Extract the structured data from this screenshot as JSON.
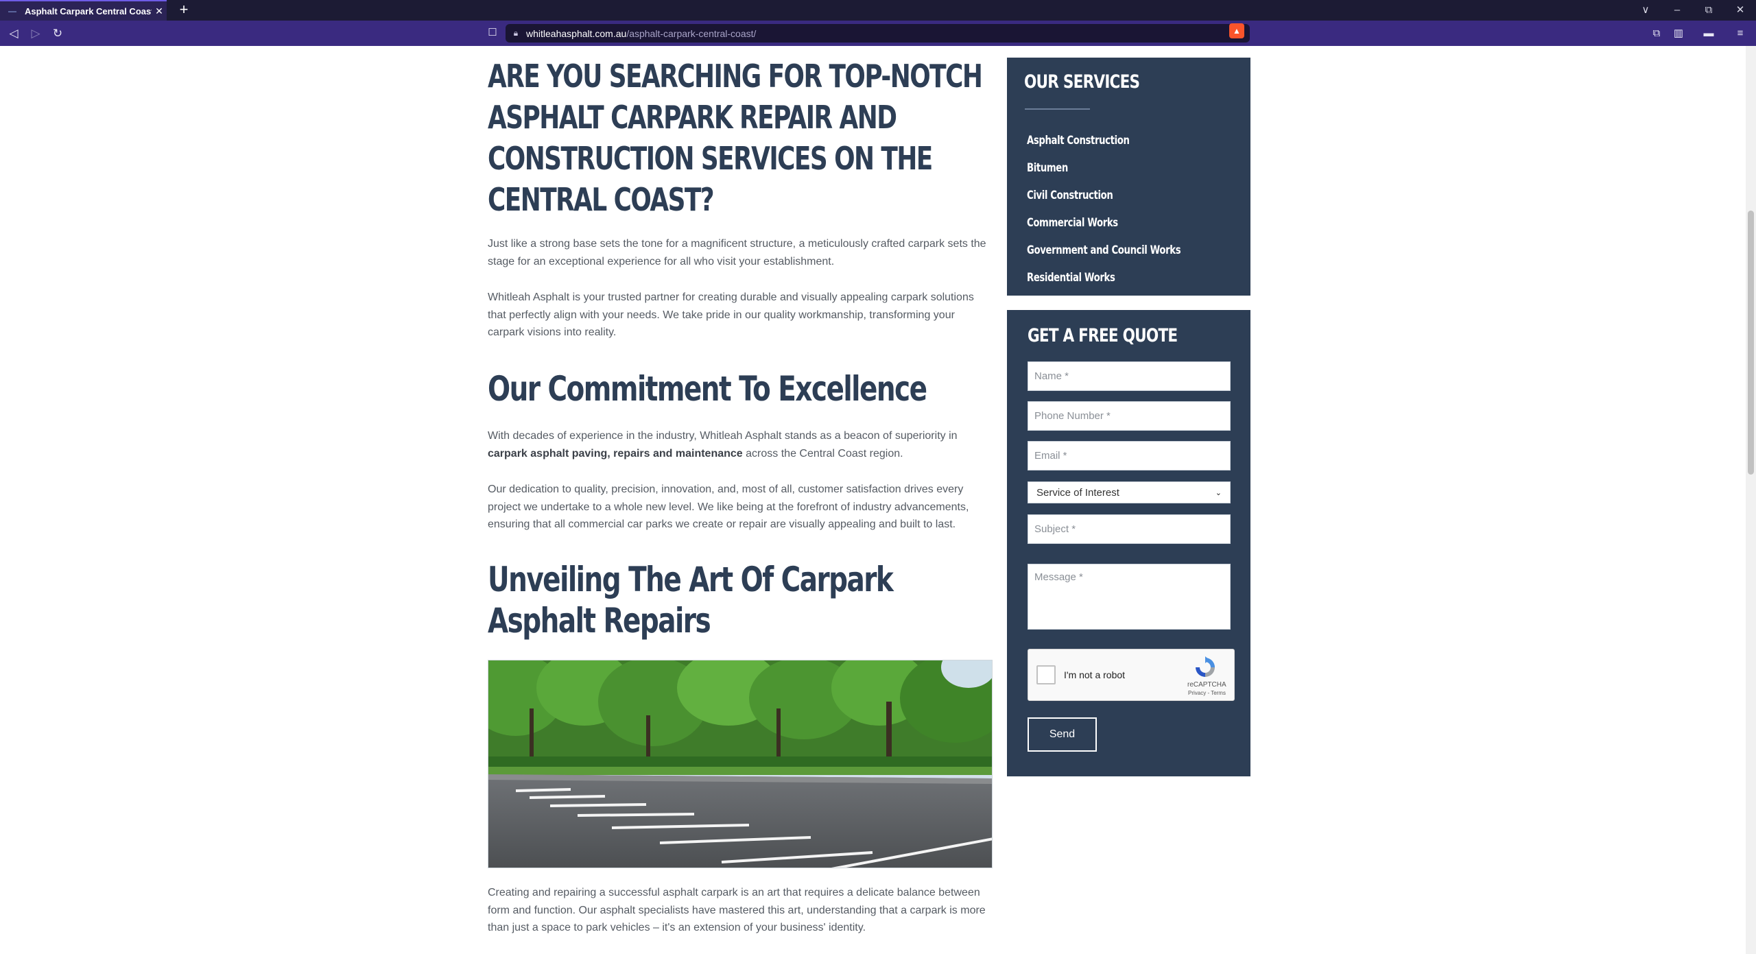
{
  "browser": {
    "tab_title": "Asphalt Carpark Central Coast - W",
    "new_tab_label": "+",
    "url_host": "whitleahasphalt.com.au",
    "url_path": "/asphalt-carpark-central-coast/"
  },
  "article": {
    "heading": "ARE YOU SEARCHING FOR TOP-NOTCH ASPHALT CARPARK REPAIR AND CONSTRUCTION SERVICES ON THE CENTRAL COAST?",
    "intro_p1": "Just like a strong base sets the tone for a magnificent structure, a meticulously crafted carpark sets the stage for an exceptional experience for all who visit your establishment.",
    "intro_p2": "Whitleah Asphalt is your trusted partner for creating durable and visually appealing carpark solutions that perfectly align with your needs. We take pride in our quality workmanship, transforming your carpark visions into reality.",
    "section1_heading": "Our Commitment To Excellence",
    "section1_p1_before": "With decades of experience in the industry, Whitleah Asphalt stands as a beacon of superiority in ",
    "section1_p1_bold": "carpark asphalt paving, repairs and maintenance",
    "section1_p1_after": " across the Central Coast region.",
    "section1_p2": "Our dedication to quality, precision, innovation, and, most of all, customer satisfaction drives every project we undertake to a whole new level. We like being at the forefront of industry advancements, ensuring that all commercial car parks we create or repair are visually appealing and built to last.",
    "section2_heading": "Unveiling The Art Of Carpark Asphalt Repairs",
    "section2_p1": "Creating and repairing a successful asphalt carpark is an art that requires a delicate balance between form and function. Our asphalt specialists have mastered this art, understanding that a carpark is more than just a space to park vehicles – it's an extension of your business' identity."
  },
  "services": {
    "title": "OUR SERVICES",
    "items": [
      "Asphalt Construction",
      "Bitumen",
      "Civil Construction",
      "Commercial Works",
      "Government and Council Works",
      "Residential Works"
    ]
  },
  "quote_form": {
    "title": "GET A FREE QUOTE",
    "name_placeholder": "Name *",
    "phone_placeholder": "Phone Number *",
    "email_placeholder": "Email *",
    "service_selected": "Service of Interest",
    "subject_placeholder": "Subject *",
    "message_placeholder": "Message *",
    "captcha_label": "I'm not a robot",
    "captcha_brand": "reCAPTCHA",
    "captcha_links": "Privacy - Terms",
    "send_label": "Send"
  },
  "colors": {
    "brand_navy": "#2d3e55",
    "browser_toolbar": "#3a2a80",
    "browser_tabbar": "#1c1b34"
  }
}
